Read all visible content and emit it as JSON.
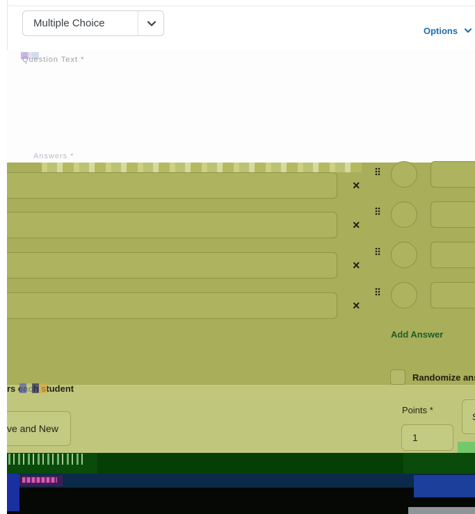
{
  "question_type": {
    "selected": "Multiple Choice"
  },
  "options_link": "Options",
  "question_text_label": "Question Text *",
  "answers_label": "Answers *",
  "answers": [
    {
      "value": "",
      "weight": ""
    },
    {
      "value": "",
      "weight": ""
    },
    {
      "value": "",
      "weight": ""
    },
    {
      "value": "",
      "weight": ""
    }
  ],
  "add_answer": "Add Answer",
  "randomize_label": "Randomize ans",
  "each_student_label": "rs  each student",
  "save_new_button": "ve and New",
  "points": {
    "label": "Points *",
    "value": "1"
  },
  "save_partial_button": "S",
  "colors": {
    "olive_panel": "#a9ae5a",
    "lower_panel": "#c0c77d",
    "link_blue": "#1b6fb3",
    "add_answer_green": "#1d5d2a"
  },
  "icons": [
    "chevron-down-icon",
    "close-icon",
    "drag-handle-icon",
    "radio-icon"
  ]
}
